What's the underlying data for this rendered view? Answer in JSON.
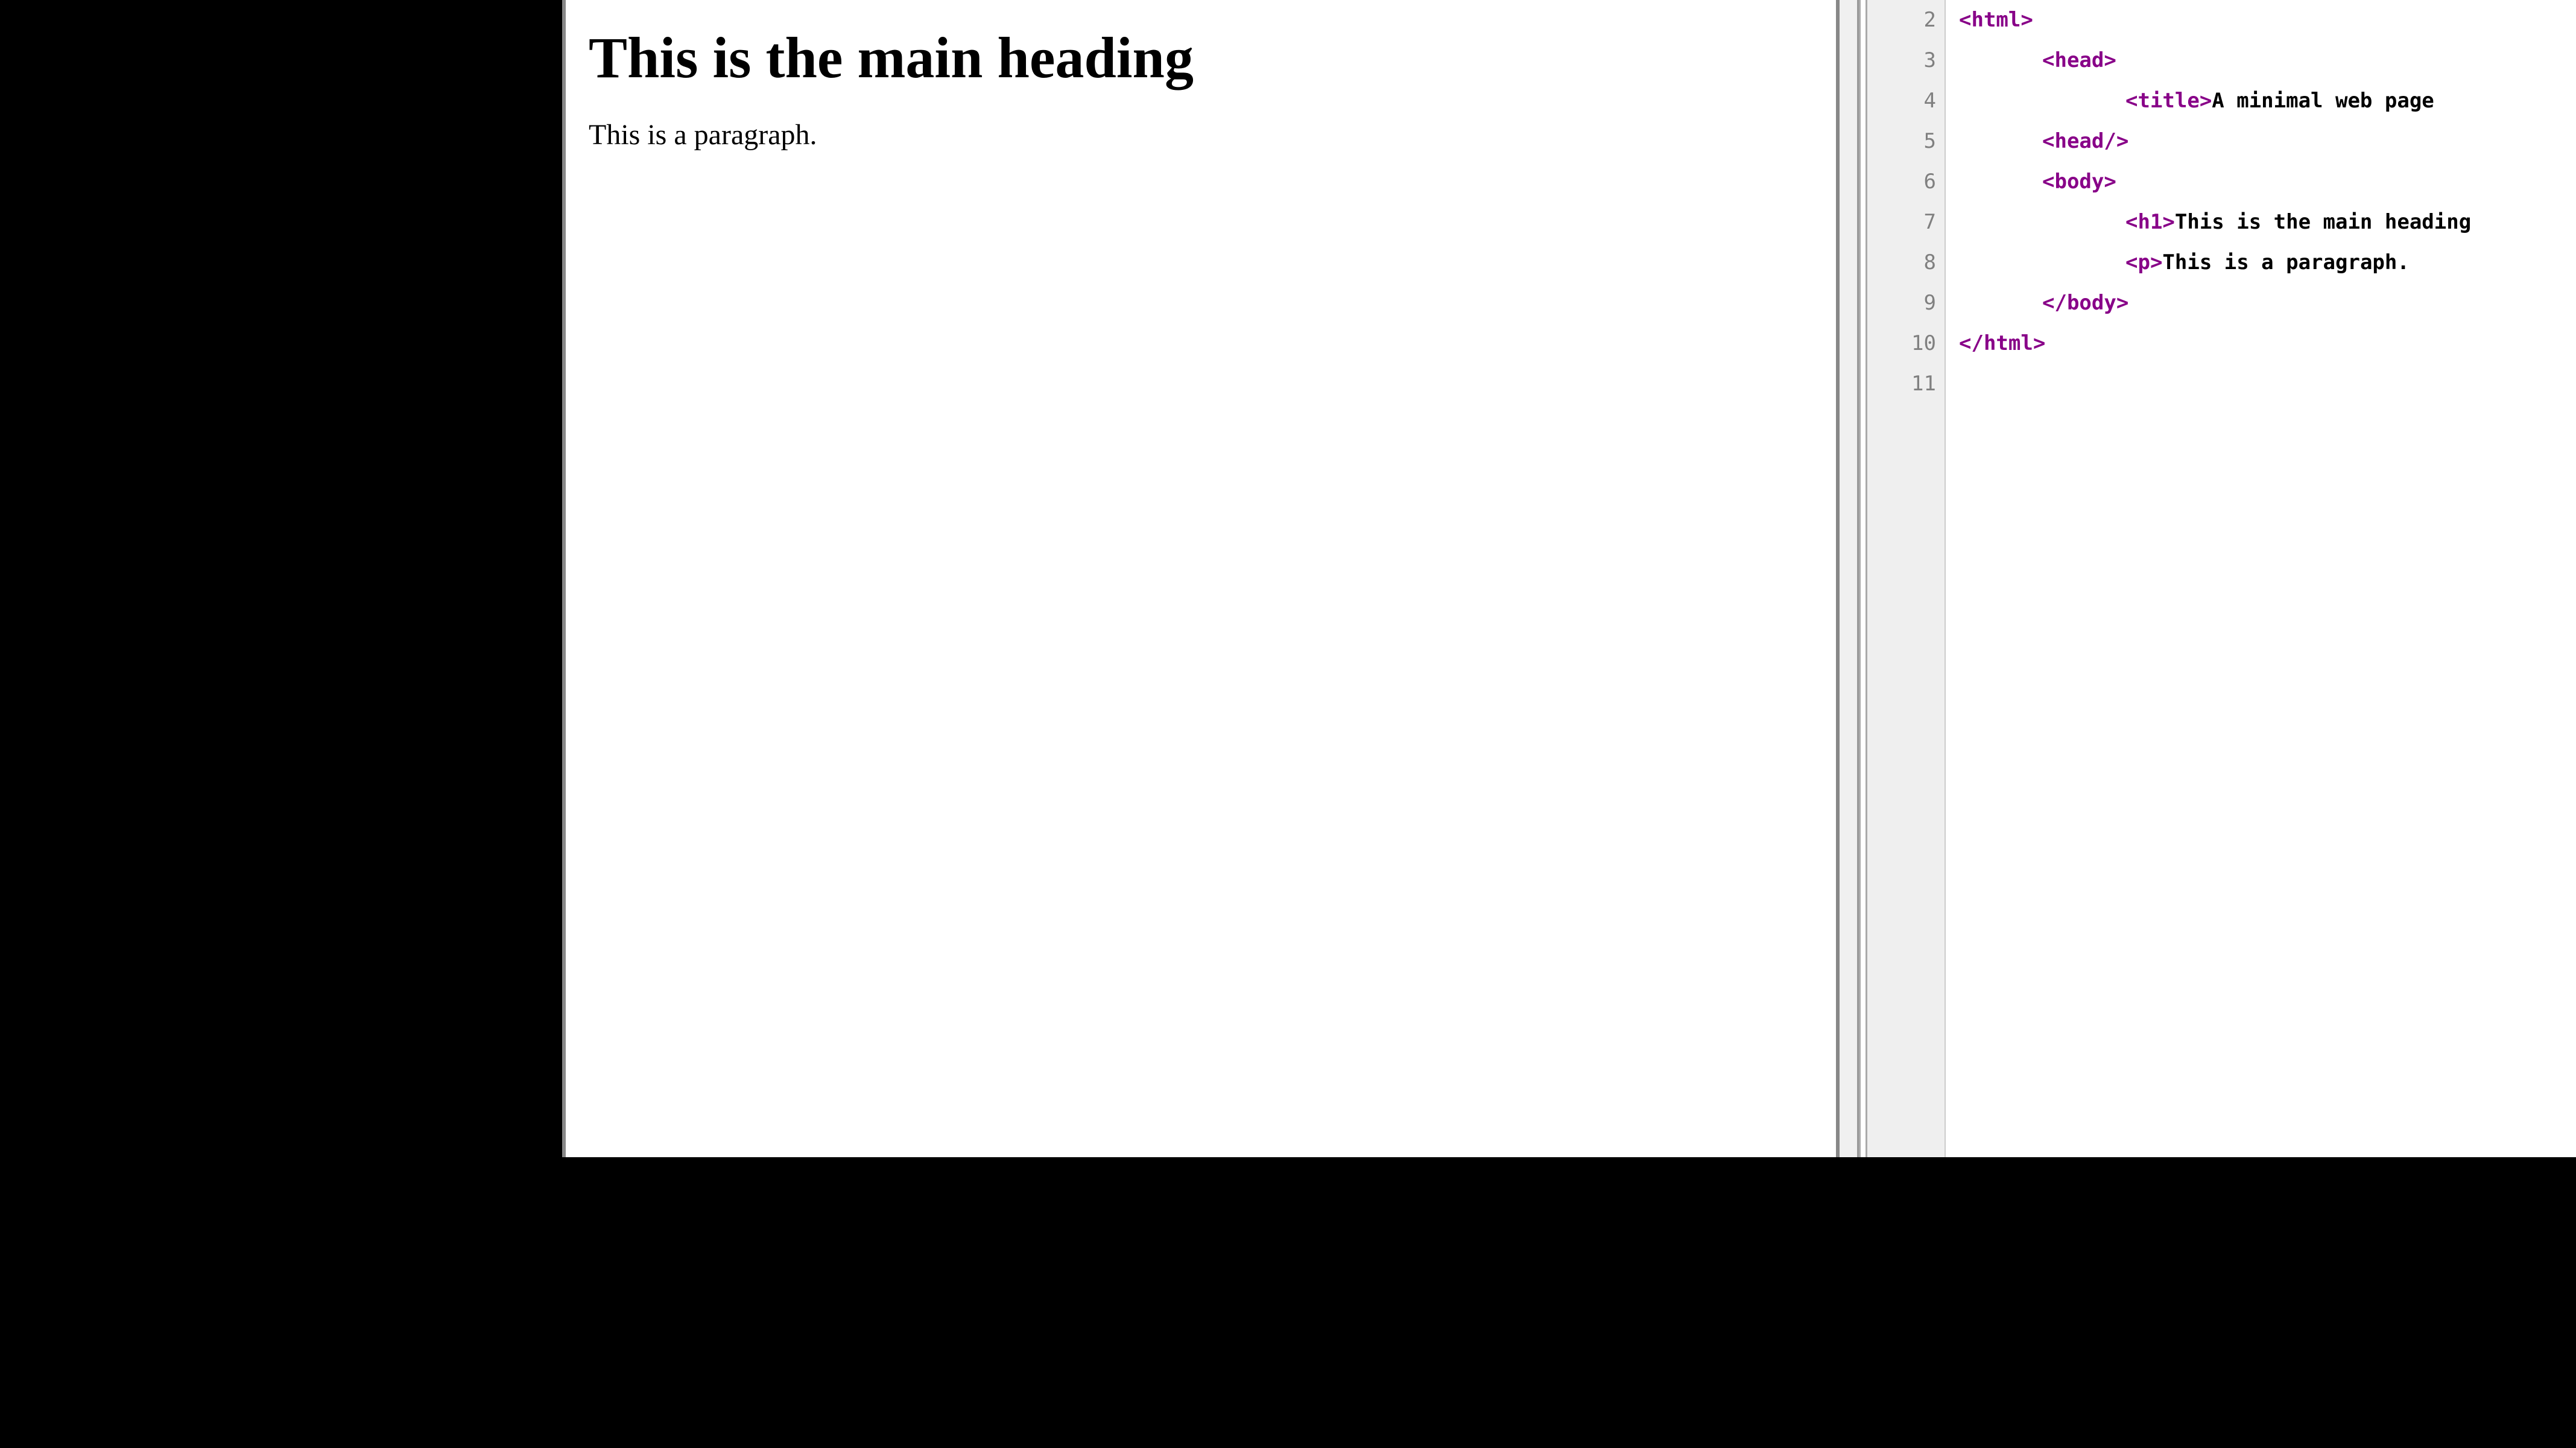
{
  "preview": {
    "heading": "This is the main heading",
    "paragraph": "This is a paragraph."
  },
  "code": {
    "gutter_start": 2,
    "lines": [
      {
        "num": 2,
        "indent": 0,
        "segments": [
          {
            "type": "tag",
            "text": "<html>"
          }
        ]
      },
      {
        "num": 3,
        "indent": 1,
        "segments": [
          {
            "type": "tag",
            "text": "<head>"
          }
        ]
      },
      {
        "num": 4,
        "indent": 2,
        "segments": [
          {
            "type": "tag",
            "text": "<title>"
          },
          {
            "type": "text",
            "text": "A minimal web page"
          }
        ]
      },
      {
        "num": 5,
        "indent": 1,
        "segments": [
          {
            "type": "tag",
            "text": "<head/>"
          }
        ]
      },
      {
        "num": 6,
        "indent": 1,
        "segments": [
          {
            "type": "tag",
            "text": "<body>"
          }
        ]
      },
      {
        "num": 7,
        "indent": 2,
        "segments": [
          {
            "type": "tag",
            "text": "<h1>"
          },
          {
            "type": "text",
            "text": "This is the main heading"
          }
        ]
      },
      {
        "num": 8,
        "indent": 2,
        "segments": [
          {
            "type": "tag",
            "text": "<p>"
          },
          {
            "type": "text",
            "text": "This is a paragraph."
          }
        ]
      },
      {
        "num": 9,
        "indent": 1,
        "segments": [
          {
            "type": "tag",
            "text": "</body>"
          }
        ]
      },
      {
        "num": 10,
        "indent": 0,
        "segments": [
          {
            "type": "tag",
            "text": "</html>"
          }
        ]
      },
      {
        "num": 11,
        "indent": 0,
        "segments": []
      }
    ]
  }
}
